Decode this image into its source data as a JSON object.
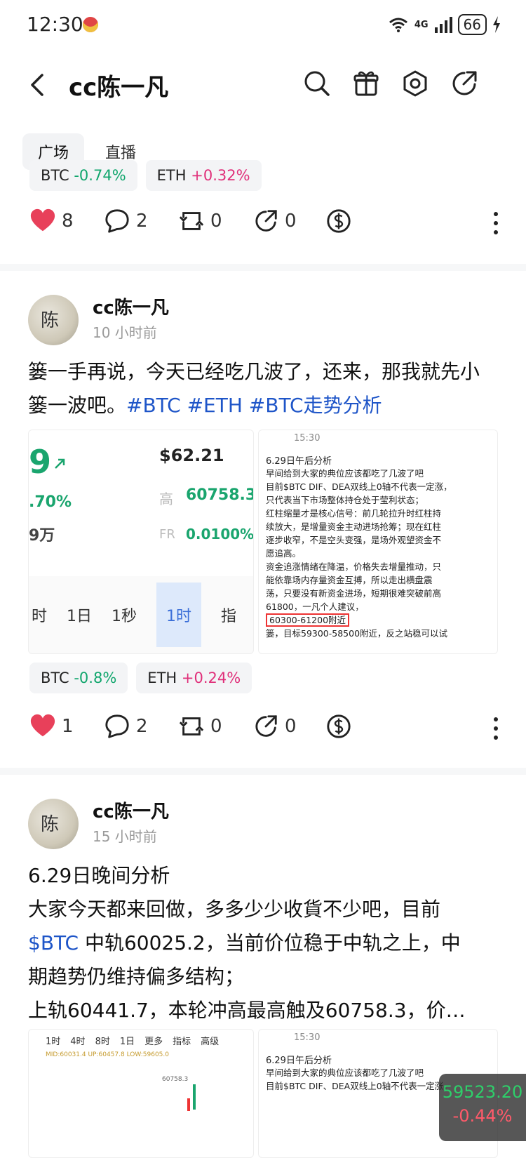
{
  "status_bar": {
    "time": "12:30",
    "network": "4G",
    "battery": "66"
  },
  "header": {
    "title": "cc陈一凡"
  },
  "tabs": [
    {
      "label": "广场",
      "active": true
    },
    {
      "label": "直播",
      "active": false
    }
  ],
  "post0": {
    "chips": [
      {
        "symbol": "BTC",
        "change": "-0.74%",
        "dir": "down"
      },
      {
        "symbol": "ETH",
        "change": "+0.32%",
        "dir": "up"
      }
    ],
    "actions": {
      "likes": "8",
      "comments": "2",
      "reposts": "0",
      "shares": "0"
    }
  },
  "post1": {
    "author": "cc陈一凡",
    "time": "10 小时前",
    "text_main": "篓一手再说，今天已经吃几波了，还来，那我就先小篓一波吧。",
    "hashtags": "#BTC #ETH #BTC走势分析",
    "left_image": {
      "big_number": "9",
      "percent": ".70%",
      "volume": "9万",
      "price": "$62.21",
      "high_label": "高",
      "high": "60758.3",
      "fr_label": "FR",
      "fr": "0.0100%",
      "tabs": [
        "时",
        "1日",
        "1秒",
        "1时",
        "指"
      ]
    },
    "right_image": {
      "time": "15:30",
      "title": "6.29日午后分析",
      "lines": [
        "早间给到大家的典位应该都吃了几波了吧",
        "目前$BTC DIF、DEA双线上0轴不代表一定涨，",
        "只代表当下市场整体持仓处于莹利状态；",
        "红柱缩量才是核心信号：前几轮拉升时红柱持",
        "续放大，是增量资金主动进场抢筹；现在红柱",
        "逐步收窄，不是空头变强，是场外观望资金不",
        "愿追高。",
        "资金追涨情绪在降温，价格失去增量推动，只",
        "能依靠场内存量资金互搏，所以走出横盘震",
        "荡，只要没有新资金进场，短期很难突破前高",
        "61800，一凡个人建议，"
      ],
      "highlight": "60300-61200附近",
      "tail": "篓，目标59300-58500附近，反之站稳可以试"
    },
    "chips": [
      {
        "symbol": "BTC",
        "change": "-0.8%",
        "dir": "down"
      },
      {
        "symbol": "ETH",
        "change": "+0.24%",
        "dir": "up"
      }
    ],
    "actions": {
      "likes": "1",
      "comments": "2",
      "reposts": "0",
      "shares": "0"
    }
  },
  "post2": {
    "author": "cc陈一凡",
    "time": "15 小时前",
    "line1": "6.29日晚间分析",
    "line2": "大家今天都来回做，多多少少收貨不少吧，目前",
    "cashtag": "$BTC",
    "line3": " 中轨60025.2，当前价位稳于中轨之上，中",
    "line4": "期趋势仍维持偏多结构；",
    "line5": "上轨60441.7，本轮冲高最高触及60758.3，价…",
    "left_image": {
      "tabs": [
        "1时",
        "4时",
        "8时",
        "1日",
        "更多",
        "指标",
        "高级"
      ],
      "indicators": "MID:60031.4 UP:60457.8 LOW:59605.0",
      "price_label": "60758.3"
    },
    "right_image": {
      "time": "15:30",
      "title": "6.29日午后分析",
      "l1": "早间给到大家的典位应该都吃了几波了吧",
      "l2": "目前$BTC DIF、DEA双线上0轴不代表一定涨，"
    }
  },
  "floating_price": {
    "price": "59523.20",
    "change": "-0.44%"
  }
}
